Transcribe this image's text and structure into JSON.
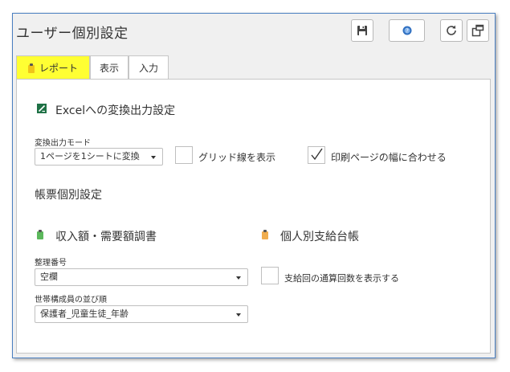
{
  "window": {
    "title": "ユーザー個別設定"
  },
  "toolbar": {
    "save_icon": "save-icon",
    "help_icon": "help-icon",
    "refresh_icon": "refresh-icon",
    "popout_icon": "popout-icon"
  },
  "tabs": [
    {
      "label": "レポート",
      "active": true,
      "highlight": "#ffff33"
    },
    {
      "label": "表示"
    },
    {
      "label": "入力"
    }
  ],
  "excel": {
    "heading": "Excelへの変換出力設定",
    "mode_label": "変換出力モード",
    "mode_value": "1ページを1シートに変換",
    "grid_label": "グリッド線を表示",
    "grid_checked": false,
    "fit_label": "印刷ページの幅に合わせる",
    "fit_checked": true
  },
  "forms": {
    "heading": "帳票個別設定",
    "income": {
      "heading": "収入額・需要額調書",
      "seiri_label": "整理番号",
      "seiri_value": "空欄",
      "order_label": "世帯構成員の並び順",
      "order_value": "保護者_児童生徒_年齢"
    },
    "personal": {
      "heading": "個人別支給台帳",
      "count_label": "支給回の通算回数を表示する",
      "count_checked": false
    }
  },
  "colors": {
    "excel_green": "#1e7145",
    "clip_green": "#5cb85c",
    "clip_orange": "#f0ad4e",
    "clip_yellow": "#f0c419",
    "help_blue": "#2f6fc0"
  }
}
